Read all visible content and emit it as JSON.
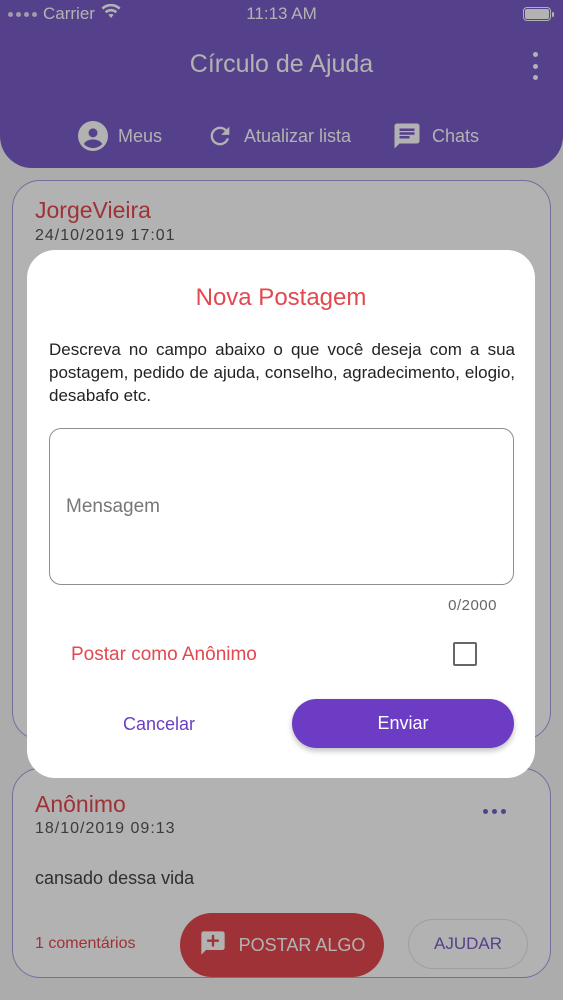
{
  "status_bar": {
    "carrier": "Carrier",
    "time": "11:13 AM"
  },
  "header": {
    "title": "Círculo de Ajuda",
    "menu_icon": "more-vertical-icon"
  },
  "toolbar": {
    "mine_label": "Meus",
    "refresh_label": "Atualizar lista",
    "chats_label": "Chats"
  },
  "posts": [
    {
      "author": "JorgeVieira",
      "date": "24/10/2019 17:01"
    },
    {
      "author": "Anônimo",
      "date": "18/10/2019 09:13",
      "content": "cansado dessa vida",
      "comments": "1 comentários",
      "help_label": "AJUDAR"
    }
  ],
  "fab": {
    "label": "POSTAR ALGO"
  },
  "modal": {
    "title": "Nova Postagem",
    "description": "Descreva no campo abaixo o que você deseja com a sua postagem, pedido de ajuda, conselho, agradecimento, elogio, desabafo etc.",
    "message_placeholder": "Mensagem",
    "message_value": "",
    "counter": "0/2000",
    "anonymous_label": "Postar como Anônimo",
    "anonymous_checked": false,
    "cancel_label": "Cancelar",
    "send_label": "Enviar"
  },
  "colors": {
    "primary": "#7a5cc8",
    "accent": "#e2484f",
    "send_button": "#6d3cc4"
  }
}
